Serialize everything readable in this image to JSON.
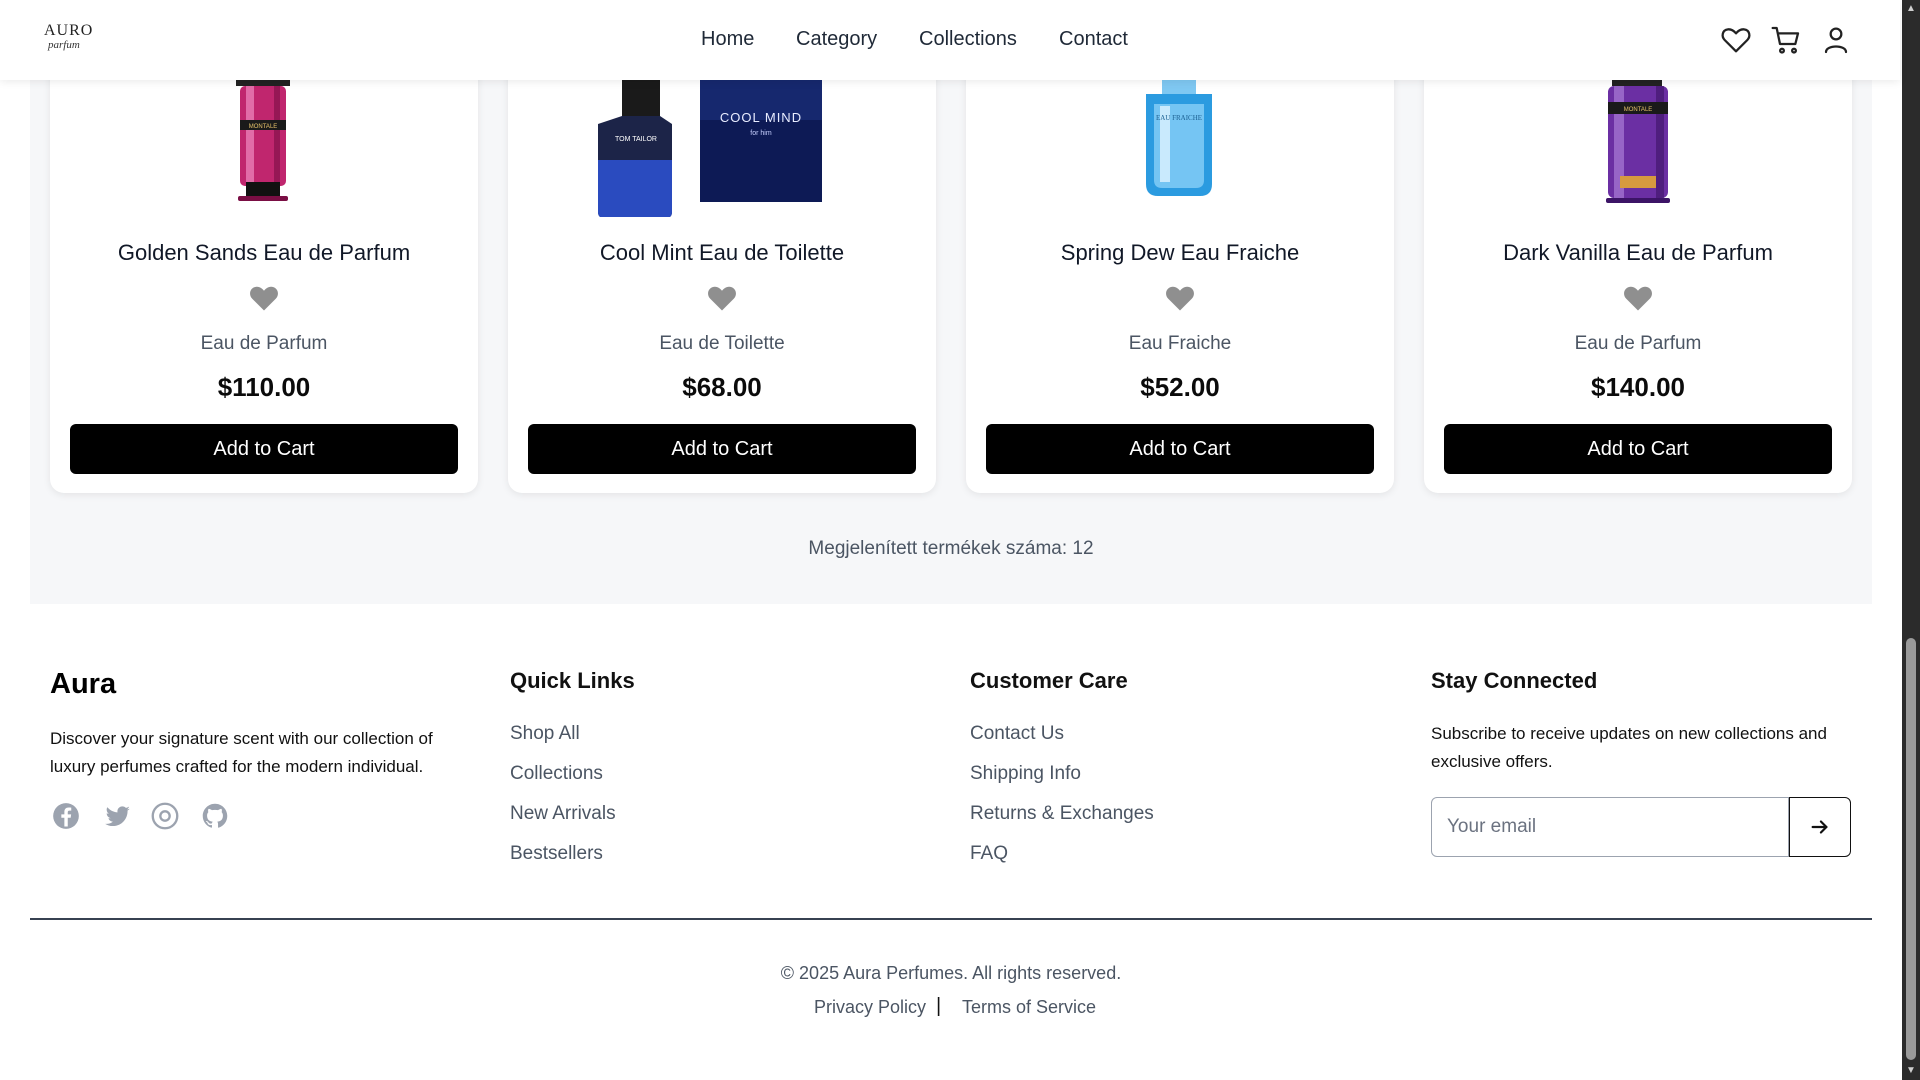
{
  "header": {
    "logo_line1": "AURO",
    "logo_line2": "parfum",
    "nav": [
      "Home",
      "Category",
      "Collections",
      "Contact"
    ],
    "icons": [
      "heart-icon",
      "cart-icon",
      "user-icon"
    ]
  },
  "products": [
    {
      "name": "Golden Sands Eau de Parfum",
      "type": "Eau de Parfum",
      "price": "$110.00",
      "button": "Add to Cart",
      "brand_on_bottle": "MONTALE",
      "bottle_color": "#c0266e"
    },
    {
      "name": "Cool Mint Eau de Toilette",
      "type": "Eau de Toilette",
      "price": "$68.00",
      "button": "Add to Cart",
      "brand_on_bottle": "TOM TAILOR",
      "box_text": "COOL MIND",
      "box_subtext": "for him",
      "bottle_color": "#1d3b8f"
    },
    {
      "name": "Spring Dew Eau Fraiche",
      "type": "Eau Fraiche",
      "price": "$52.00",
      "button": "Add to Cart",
      "brand_on_bottle": "EAU FRAICHE",
      "bottle_color": "#2b9be0"
    },
    {
      "name": "Dark Vanilla Eau de Parfum",
      "type": "Eau de Parfum",
      "price": "$140.00",
      "button": "Add to Cart",
      "brand_on_bottle": "MONTALE",
      "bottle_color": "#6b2fa3"
    }
  ],
  "product_count_text": "Megjelenített termékek száma: 12",
  "footer": {
    "brand": "Aura",
    "description": "Discover your signature scent with our collection of luxury perfumes crafted for the modern individual.",
    "social_icons": [
      "facebook-icon",
      "twitter-icon",
      "instagram-icon",
      "github-icon"
    ],
    "quick_links": {
      "title": "Quick Links",
      "links": [
        "Shop All",
        "Collections",
        "New Arrivals",
        "Bestsellers"
      ]
    },
    "customer_care": {
      "title": "Customer Care",
      "links": [
        "Contact Us",
        "Shipping Info",
        "Returns & Exchanges",
        "FAQ"
      ]
    },
    "stay_connected": {
      "title": "Stay Connected",
      "text": "Subscribe to receive updates on new collections and exclusive offers.",
      "email_placeholder": "Your email"
    },
    "copyright": "© 2025 Aura Perfumes. All rights reserved.",
    "privacy": "Privacy Policy",
    "separator": "|",
    "terms": "Terms of Service"
  },
  "colors": {
    "button_bg": "#000000",
    "heart_gray": "#8f8f8f",
    "section_bg": "#f6f7f9"
  }
}
